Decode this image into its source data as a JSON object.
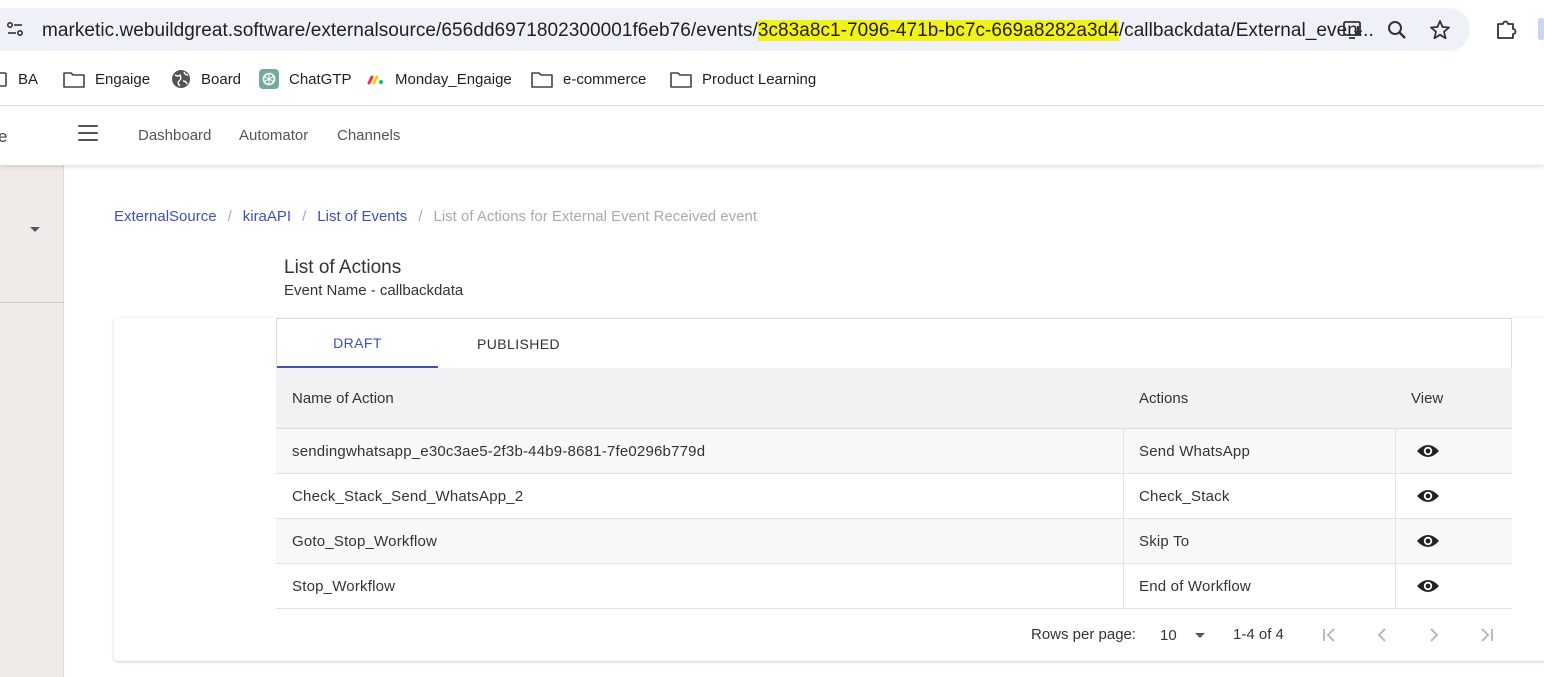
{
  "browser": {
    "url_prefix": "marketic.webuildgreat.software/externalsource/656dd6971802300001f6eb76/events/",
    "url_highlight": "3c83a8c1-7096-471b-bc7c-669a8282a3d4",
    "url_suffix": "/callbackdata/External_even...",
    "highlight_color": "#f2f216",
    "bookmarks": [
      {
        "label": "BA",
        "icon": "folder-icon"
      },
      {
        "label": "Engaige",
        "icon": "folder-icon"
      },
      {
        "label": "Board",
        "icon": "globe-icon"
      },
      {
        "label": "ChatGTP",
        "icon": "chatgpt-icon"
      },
      {
        "label": "Monday_Engaige",
        "icon": "monday-icon"
      },
      {
        "label": "e-commerce",
        "icon": "folder-icon"
      },
      {
        "label": "Product Learning",
        "icon": "folder-icon"
      }
    ]
  },
  "app": {
    "logo_fragment": "e",
    "nav": [
      "Dashboard",
      "Automator",
      "Channels"
    ],
    "accent_color": "#3f51b5"
  },
  "breadcrumb": {
    "items": [
      "ExternalSource",
      "kiraAPI",
      "List of Events"
    ],
    "current": "List of Actions for External Event Received event",
    "separator": "/"
  },
  "page": {
    "title": "List of Actions",
    "subtitle": "Event Name - callbackdata"
  },
  "tabs": [
    {
      "label": "DRAFT",
      "active": true
    },
    {
      "label": "PUBLISHED",
      "active": false
    }
  ],
  "table": {
    "headers": [
      "Name of Action",
      "Actions",
      "View"
    ],
    "rows": [
      {
        "name": "sendingwhatsapp_e30c3ae5-2f3b-44b9-8681-7fe0296b779d",
        "action": "Send WhatsApp",
        "view_icon": "eye-icon"
      },
      {
        "name": "Check_Stack_Send_WhatsApp_2",
        "action": "Check_Stack",
        "view_icon": "eye-icon"
      },
      {
        "name": "Goto_Stop_Workflow",
        "action": "Skip To",
        "view_icon": "eye-icon"
      },
      {
        "name": "Stop_Workflow",
        "action": "End of Workflow",
        "view_icon": "eye-icon"
      }
    ]
  },
  "pagination": {
    "rows_per_page_label": "Rows per page:",
    "rows_per_page": "10",
    "range": "1-4 of 4"
  }
}
